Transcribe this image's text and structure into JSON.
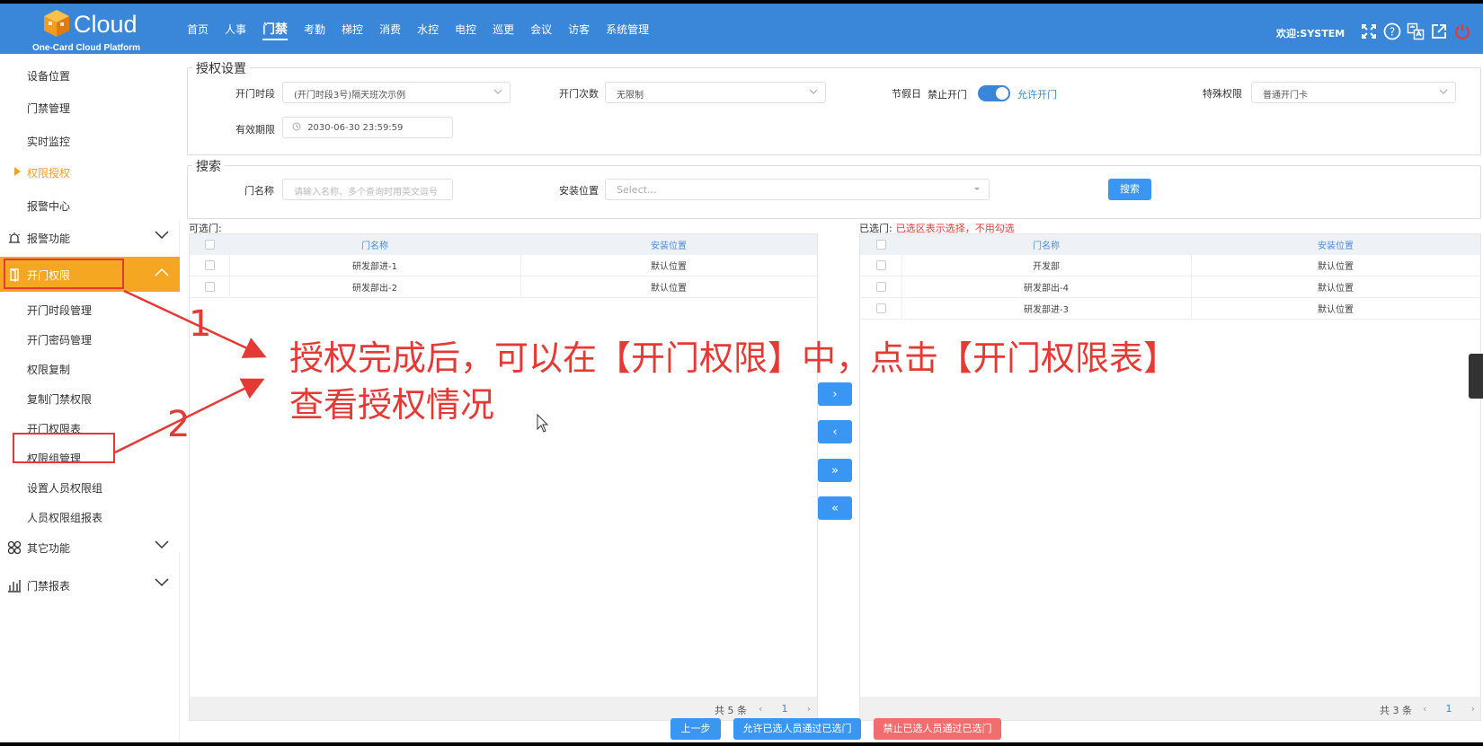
{
  "header": {
    "logo_text": "Cloud",
    "logo_sub": "One-Card Cloud Platform",
    "nav": [
      "首页",
      "人事",
      "门禁",
      "考勤",
      "梯控",
      "消费",
      "水控",
      "电控",
      "巡更",
      "会议",
      "访客",
      "系统管理"
    ],
    "nav_active": "门禁",
    "welcome": "欢迎:SYSTEM",
    "icons": [
      "fullscreen-icon",
      "help-icon",
      "translate-icon",
      "external-link-icon",
      "power-icon"
    ]
  },
  "sidebar": {
    "top_items": [
      "设备位置",
      "门禁管理",
      "实时监控",
      "权限授权",
      "报警中心"
    ],
    "active_item": "权限授权",
    "groups": {
      "alarm": "报警功能",
      "door_perm": "开门权限",
      "other": "其它功能",
      "report": "门禁报表"
    },
    "door_perm_items": [
      "开门时段管理",
      "开门密码管理",
      "权限复制",
      "复制门禁权限",
      "开门权限表",
      "权限组管理",
      "设置人员权限组",
      "人员权限组报表"
    ]
  },
  "auth": {
    "legend": "授权设置",
    "period_label": "开门时段",
    "period_value": "(开门时段3号)隔天班次示例",
    "count_label": "开门次数",
    "count_value": "无限制",
    "holiday_label": "节假日",
    "holiday_off": "禁止开门",
    "holiday_on": "允许开门",
    "holiday_allowed": true,
    "special_label": "特殊权限",
    "special_value": "普通开门卡",
    "valid_label": "有效期限",
    "valid_value": "2030-06-30 23:59:59"
  },
  "search": {
    "legend": "搜索",
    "door_label": "门名称",
    "door_placeholder": "请输入名称、多个查询时用英文逗号",
    "loc_label": "安装位置",
    "loc_placeholder": "Select...",
    "button": "搜索"
  },
  "left_panel": {
    "title": "可选门:",
    "columns": [
      "门名称",
      "安装位置"
    ],
    "rows": [
      {
        "name": "研发部进-1",
        "loc": "默认位置"
      },
      {
        "name": "研发部出-2",
        "loc": "默认位置"
      }
    ],
    "total": "共 5 条",
    "page": "1"
  },
  "right_panel": {
    "title": "已选门:",
    "note": "已选区表示选择，不用勾选",
    "columns": [
      "门名称",
      "安装位置"
    ],
    "rows": [
      {
        "name": "开发部",
        "loc": "默认位置"
      },
      {
        "name": "研发部出-4",
        "loc": "默认位置"
      },
      {
        "name": "研发部进-3",
        "loc": "默认位置"
      }
    ],
    "total": "共 3 条",
    "page": "1"
  },
  "transfer_buttons": [
    "›",
    "‹",
    "»",
    "«"
  ],
  "footer": {
    "prev": "上一步",
    "allow": "允许已选人员通过已选门",
    "deny": "禁止已选人员通过已选门"
  },
  "annotation": {
    "num1": "1",
    "num2": "2",
    "line1": "授权完成后，可以在【开门权限】中，点击【开门权限表】",
    "line2": "查看授权情况"
  },
  "colors": {
    "header": "#3a86d8",
    "accent": "#f5a623",
    "button": "#3a96f3",
    "danger": "#f26d6d",
    "annotation": "#e53935"
  }
}
